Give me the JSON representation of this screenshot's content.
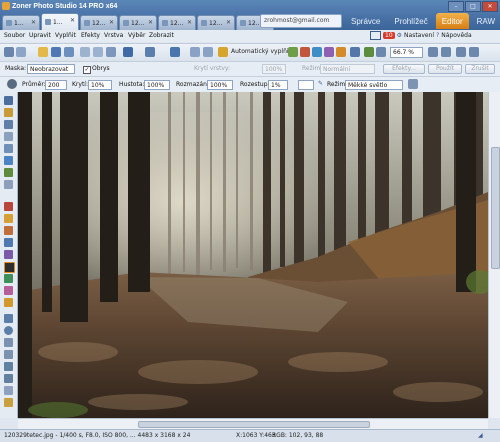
{
  "app": {
    "title": "Zoner Photo Studio 14 PRO x64"
  },
  "tabs": [
    {
      "label": "1...",
      "active": false
    },
    {
      "label": "1...",
      "active": true
    },
    {
      "label": "12...",
      "active": false
    },
    {
      "label": "12...",
      "active": false
    },
    {
      "label": "12...",
      "active": false
    },
    {
      "label": "12...",
      "active": false
    },
    {
      "label": "12...",
      "active": false
    }
  ],
  "account": {
    "email": "zrohmost@gmail.com"
  },
  "modules": [
    {
      "label": "Správce",
      "active": false
    },
    {
      "label": "Prohlížeč",
      "active": false
    },
    {
      "label": "Editor",
      "active": true
    },
    {
      "label": "RAW",
      "active": false
    }
  ],
  "menu": {
    "items": [
      "Soubor",
      "Upravit",
      "Vyplňit",
      "Efekty",
      "Vrstva",
      "Výběr",
      "Zobrazit"
    ]
  },
  "header_tools": {
    "badge_count": "10",
    "settings_label": "Nastavení",
    "help_label": "Nápověda"
  },
  "toolbar": {
    "auto_fill_label": "Automatický vyplňit",
    "zoom_value": "66.7 %"
  },
  "options_row1": {
    "mask_label": "Maska:",
    "mask_value": "Neobrazovat",
    "outline_label": "Obrys",
    "layer_opacity_label": "Krytí vrstvy:",
    "layer_opacity_value": "100%",
    "mode_label": "Režim:",
    "mode_value": "Normální",
    "effects_label": "Efekty...",
    "apply_label": "Použít",
    "cancel_label": "Zrušit"
  },
  "options_row2": {
    "diameter_label": "Průměr:",
    "diameter_value": "200",
    "opacity_label": "Krytí:",
    "opacity_value": "10%",
    "density_label": "Hustota:",
    "density_value": "100%",
    "blur_label": "Rozmazání:",
    "blur_value": "100%",
    "spacing_label": "Rozestup:",
    "spacing_value": "1%",
    "mode_label": "Režim:",
    "mode_value": "Měkké světlo"
  },
  "status": {
    "file_info": "120329tetec.jpg - 1/400 s, F8.0, ISO 800, ... 4483 x 3168 x 24",
    "coords": "X:1063 Y:463",
    "rgb": "RGB: 102, 93, 88"
  },
  "colors": {
    "accent": "#e08a22",
    "title_bar": "#4a74a8"
  }
}
